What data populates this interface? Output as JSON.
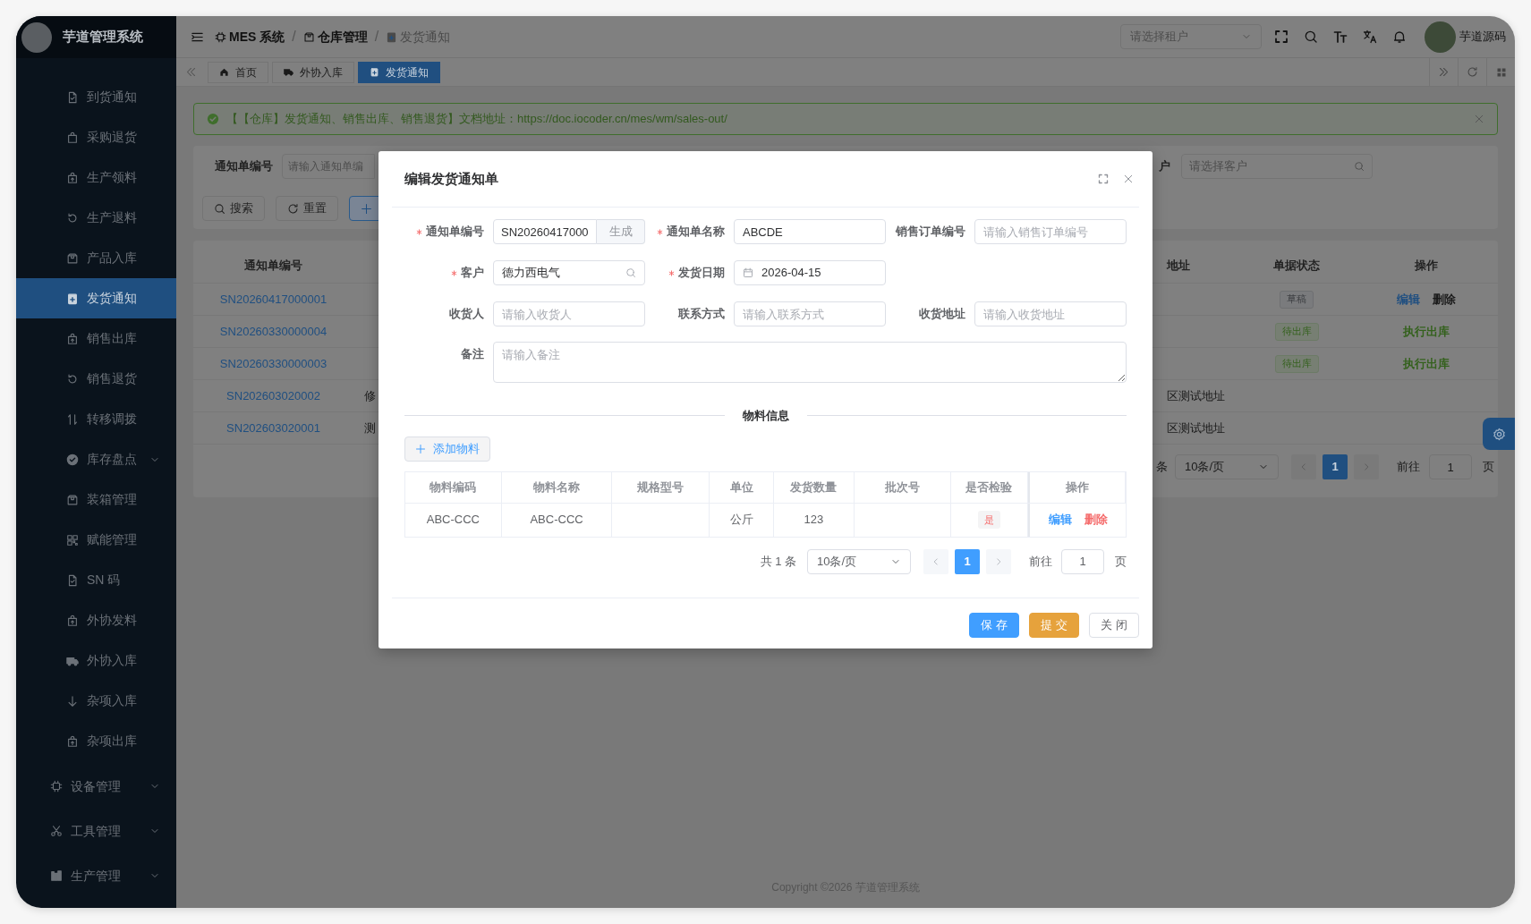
{
  "app": {
    "title": "芋道管理系统"
  },
  "sidebar": {
    "items": [
      {
        "label": "到货通知",
        "kind": "link",
        "selected": false
      },
      {
        "label": "采购退货",
        "kind": "link",
        "selected": false
      },
      {
        "label": "生产领料",
        "kind": "link",
        "selected": false
      },
      {
        "label": "生产退料",
        "kind": "link",
        "selected": false
      },
      {
        "label": "产品入库",
        "kind": "link",
        "selected": false
      },
      {
        "label": "发货通知",
        "kind": "link",
        "selected": true
      },
      {
        "label": "销售出库",
        "kind": "link",
        "selected": false
      },
      {
        "label": "销售退货",
        "kind": "link",
        "selected": false
      },
      {
        "label": "转移调拨",
        "kind": "link",
        "selected": false
      },
      {
        "label": "库存盘点",
        "kind": "submenu",
        "selected": false,
        "expanded": false
      },
      {
        "label": "装箱管理",
        "kind": "link",
        "selected": false
      },
      {
        "label": "赋能管理",
        "kind": "link",
        "selected": false
      },
      {
        "label": "SN 码",
        "kind": "link",
        "selected": false
      },
      {
        "label": "外协发料",
        "kind": "link",
        "selected": false
      },
      {
        "label": "外协入库",
        "kind": "link",
        "selected": false
      },
      {
        "label": "杂项入库",
        "kind": "link",
        "selected": false
      },
      {
        "label": "杂项出库",
        "kind": "link",
        "selected": false
      }
    ],
    "groups": [
      {
        "label": "设备管理",
        "expanded": false
      },
      {
        "label": "工具管理",
        "expanded": false
      },
      {
        "label": "生产管理",
        "expanded": false
      }
    ]
  },
  "header": {
    "separator": "/",
    "breadcrumb": [
      {
        "label": "MES 系统"
      },
      {
        "label": "仓库管理"
      },
      {
        "label": "发货通知"
      }
    ],
    "tenant_select": {
      "placeholder": "请选择租户"
    },
    "user": {
      "name": "芋道源码"
    }
  },
  "tabs": [
    {
      "label": "首页",
      "selected": false
    },
    {
      "label": "外协入库",
      "selected": false
    },
    {
      "label": "发货通知",
      "selected": true
    }
  ],
  "alert": {
    "text": "【【仓库】发货通知、销售出库、销售退货】文档地址：https://doc.iocoder.cn/mes/wm/sales-out/"
  },
  "search_form": {
    "fields": [
      {
        "label": "通知单编号",
        "placeholder": "请输入通知单编"
      },
      {
        "label": "户",
        "placeholder": "请选择客户"
      }
    ],
    "buttons": [
      {
        "label": "搜索",
        "kind": "search"
      },
      {
        "label": "重置",
        "kind": "reset"
      },
      {
        "kind": "add"
      }
    ]
  },
  "table": {
    "columns": {
      "number": "通知单编号",
      "address": "地址",
      "status": "单据状态",
      "actions": "操作"
    },
    "rows": [
      {
        "number": "SN20260417000001",
        "status": {
          "label": "草稿",
          "kind": "info"
        },
        "actions": [
          {
            "label": "编辑",
            "kind": "primary"
          },
          {
            "label": "删除",
            "kind": "default"
          }
        ]
      },
      {
        "number": "SN20260330000004",
        "status": {
          "label": "待出库",
          "kind": "success"
        },
        "actions": [
          {
            "label": "执行出库",
            "kind": "success"
          }
        ]
      },
      {
        "number": "SN20260330000003",
        "status": {
          "label": "待出库",
          "kind": "success"
        },
        "actions": [
          {
            "label": "执行出库",
            "kind": "success"
          }
        ]
      },
      {
        "number": "SN202603020002",
        "column_2": "修",
        "address": "区测试地址"
      },
      {
        "number": "SN202603020001",
        "column_2": "测",
        "address": "区测试地址"
      }
    ],
    "pagination": {
      "total": "条",
      "page_size": "10条/页",
      "pages": [
        {
          "label": "1",
          "selected": true
        }
      ],
      "goto_label": "前往",
      "goto_value": "1",
      "page_unit": "页"
    }
  },
  "footer": {
    "text": "Copyright ©2026 芋道管理系统"
  },
  "dialog": {
    "title": "编辑发货通知单",
    "rows": [
      [
        {
          "label": "通知单编号",
          "required": true,
          "kind": "generate",
          "value": "SN20260417000",
          "button": "生成"
        },
        {
          "label": "通知单名称",
          "required": true,
          "kind": "text",
          "value": "ABCDE"
        },
        {
          "label": "销售订单编号",
          "required": false,
          "kind": "text",
          "placeholder": "请输入销售订单编号"
        }
      ],
      [
        {
          "label": "客户",
          "required": true,
          "kind": "search",
          "value": "德力西电气"
        },
        {
          "label": "发货日期",
          "required": true,
          "kind": "date",
          "value": "2026-04-15"
        }
      ],
      [
        {
          "label": "收货人",
          "required": false,
          "kind": "text",
          "placeholder": "请输入收货人"
        },
        {
          "label": "联系方式",
          "required": false,
          "kind": "text",
          "placeholder": "请输入联系方式"
        },
        {
          "label": "收货地址",
          "required": false,
          "kind": "text",
          "placeholder": "请输入收货地址"
        }
      ],
      [
        {
          "label": "备注",
          "required": false,
          "kind": "textarea",
          "placeholder": "请输入备注"
        }
      ]
    ],
    "section_title": "物料信息",
    "add_button": "添加物料",
    "items_table": {
      "columns": [
        "物料编码",
        "物料名称",
        "规格型号",
        "单位",
        "发货数量",
        "批次号",
        "是否检验",
        "操作"
      ],
      "rows": [
        {
          "code": "ABC-CCC",
          "name": "ABC-CCC",
          "unit": "公斤",
          "quantity": "123",
          "inspection": "是",
          "actions": [
            {
              "label": "编辑",
              "kind": "primary"
            },
            {
              "label": "删除",
              "kind": "danger"
            }
          ]
        }
      ]
    },
    "pagination": {
      "total": "共 1 条",
      "page_size": "10条/页",
      "pages": [
        {
          "label": "1",
          "selected": true
        }
      ],
      "goto_label": "前往",
      "goto_value": "1",
      "page_unit": "页"
    },
    "buttons": [
      {
        "label": "保 存",
        "kind": "primary"
      },
      {
        "label": "提 交",
        "kind": "warning"
      },
      {
        "label": "关 闭",
        "kind": "default"
      }
    ]
  }
}
